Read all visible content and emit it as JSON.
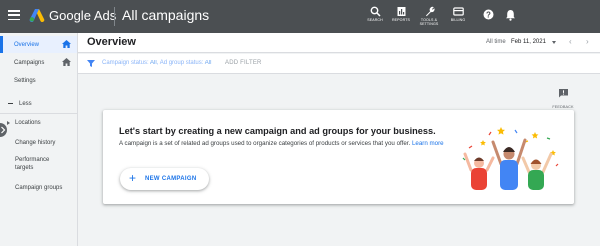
{
  "topbar": {
    "product_name": "Google Ads",
    "page_title": "All campaigns",
    "tools": [
      {
        "label": "SEARCH"
      },
      {
        "label": "REPORTS"
      },
      {
        "label_line1": "TOOLS &",
        "label_line2": "SETTINGS"
      },
      {
        "label": "BILLING"
      }
    ]
  },
  "sidebar": {
    "items": [
      {
        "label": "Overview"
      },
      {
        "label": "Campaigns"
      },
      {
        "label": "Settings"
      }
    ],
    "less_label": "Less",
    "more_items": [
      {
        "label": "Locations"
      },
      {
        "label": "Change history"
      },
      {
        "label_line1": "Performance",
        "label_line2": "targets"
      },
      {
        "label": "Campaign groups"
      }
    ]
  },
  "header": {
    "title": "Overview",
    "range_label": "All time",
    "date": "Feb 11, 2021"
  },
  "filter": {
    "status_prefix": "Campaign status: ",
    "status_value": "All",
    "group_prefix": ", Ad group status: ",
    "group_value": "All",
    "add_filter": "ADD FILTER"
  },
  "feedback": {
    "label": "FEEDBACK"
  },
  "card": {
    "title": "Let's start by creating a new campaign and ad groups for your business.",
    "description": "A campaign is a set of related ad groups used to organize categories of products or services that you offer.",
    "learn_more": "Learn more",
    "button_label": "NEW CAMPAIGN"
  },
  "colors": {
    "topbar": "#4b4f52",
    "accent": "#1a73e8",
    "background": "#f1f3f4"
  }
}
